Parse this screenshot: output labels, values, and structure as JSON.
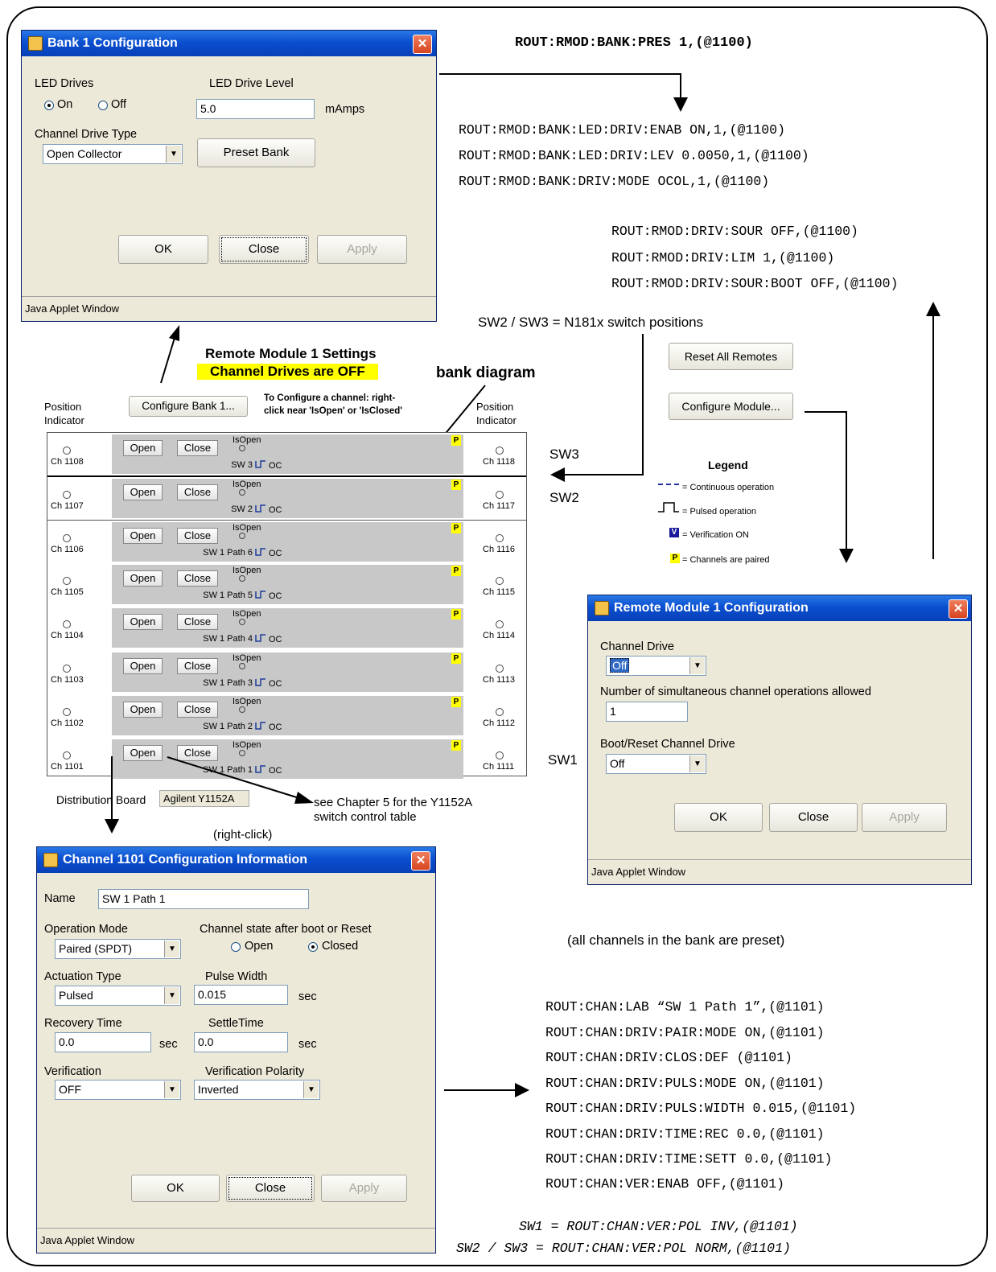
{
  "commands": {
    "top": "ROUT:RMOD:BANK:PRES 1,(@1100)",
    "bank": [
      "ROUT:RMOD:BANK:LED:DRIV:ENAB ON,1,(@1100)",
      "ROUT:RMOD:BANK:LED:DRIV:LEV 0.0050,1,(@1100)",
      "ROUT:RMOD:BANK:DRIV:MODE OCOL,1,(@1100)"
    ],
    "module": [
      "ROUT:RMOD:DRIV:SOUR OFF,(@1100)",
      "ROUT:RMOD:DRIV:LIM 1,(@1100)",
      "ROUT:RMOD:DRIV:SOUR:BOOT OFF,(@1100)"
    ],
    "channel": [
      "ROUT:CHAN:LAB “SW 1 Path 1”,(@1101)",
      "ROUT:CHAN:DRIV:PAIR:MODE ON,(@1101)",
      "ROUT:CHAN:DRIV:CLOS:DEF (@1101)",
      "ROUT:CHAN:DRIV:PULS:MODE ON,(@1101)",
      "ROUT:CHAN:DRIV:PULS:WIDTH 0.015,(@1101)",
      "ROUT:CHAN:DRIV:TIME:REC 0.0,(@1101)",
      "ROUT:CHAN:DRIV:TIME:SETT 0.0,(@1101)",
      "ROUT:CHAN:VER:ENAB OFF,(@1101)"
    ],
    "pol_sw1": "SW1 = ROUT:CHAN:VER:POL INV,(@1101)",
    "pol_sw23": "SW2 / SW3 = ROUT:CHAN:VER:POL NORM,(@1101)"
  },
  "annotations": {
    "switch_positions": "SW2 / SW3 = N181x switch positions",
    "bank_diagram": "bank diagram",
    "see_chapter": "see Chapter 5 for the Y1152A",
    "see_chapter2": "switch control table",
    "right_click": "(right-click)",
    "all_preset": "(all channels in the bank are preset)",
    "sw3": "SW3",
    "sw2": "SW2",
    "sw1": "SW1"
  },
  "bank_dialog": {
    "title": "Bank 1 Configuration",
    "led_drives_label": "LED Drives",
    "on_label": "On",
    "off_label": "Off",
    "led_level_label": "LED Drive Level",
    "led_level_value": "5.0",
    "led_level_unit": "mAmps",
    "drive_type_label": "Channel Drive Type",
    "drive_type_value": "Open Collector",
    "preset_bank": "Preset Bank",
    "ok": "OK",
    "close": "Close",
    "apply": "Apply",
    "footer": "Java Applet Window"
  },
  "panel": {
    "settings_title": "Remote Module 1 Settings",
    "drives_status": "Channel Drives are OFF",
    "position_indicator": "Position Indicator",
    "configure_bank": "Configure Bank 1...",
    "configure_hint1": "To Configure a channel: right-",
    "configure_hint2": "click near 'IsOpen' or 'IsClosed'",
    "reset_all": "Reset All Remotes",
    "configure_module": "Configure Module...",
    "distribution_label": "Distribution Board",
    "distribution_value": "Agilent Y1152A",
    "open": "Open",
    "close": "Close",
    "isopen": "IsOpen",
    "oc": "OC",
    "p": "P",
    "rows": [
      {
        "left": "Ch 1108",
        "right": "Ch 1118",
        "label": "SW 3"
      },
      {
        "left": "Ch 1107",
        "right": "Ch 1117",
        "label": "SW 2"
      },
      {
        "left": "Ch 1106",
        "right": "Ch 1116",
        "label": "SW 1 Path 6"
      },
      {
        "left": "Ch 1105",
        "right": "Ch 1115",
        "label": "SW 1 Path 5"
      },
      {
        "left": "Ch 1104",
        "right": "Ch 1114",
        "label": "SW 1 Path 4"
      },
      {
        "left": "Ch 1103",
        "right": "Ch 1113",
        "label": "SW 1 Path 3"
      },
      {
        "left": "Ch 1102",
        "right": "Ch 1112",
        "label": "SW 1 Path 2"
      },
      {
        "left": "Ch 1101",
        "right": "Ch 1111",
        "label": "SW 1 Path 1"
      }
    ]
  },
  "legend": {
    "title": "Legend",
    "continuous": "= Continuous operation",
    "pulsed": "= Pulsed operation",
    "verification": "= Verification ON",
    "paired": "= Channels are paired",
    "v": "V",
    "p": "P"
  },
  "module_dialog": {
    "title": "Remote Module 1 Configuration",
    "channel_drive_label": "Channel Drive",
    "channel_drive_value": "Off",
    "simultaneous_label": "Number of simultaneous channel operations allowed",
    "simultaneous_value": "1",
    "boot_label": "Boot/Reset Channel Drive",
    "boot_value": "Off",
    "ok": "OK",
    "close": "Close",
    "apply": "Apply",
    "footer": "Java Applet Window"
  },
  "channel_dialog": {
    "title": "Channel 1101 Configuration Information",
    "name_label": "Name",
    "name_value": "SW 1 Path 1",
    "op_mode_label": "Operation Mode",
    "op_mode_value": "Paired (SPDT)",
    "state_label": "Channel state after boot or Reset",
    "state_open": "Open",
    "state_closed": "Closed",
    "actuation_label": "Actuation Type",
    "actuation_value": "Pulsed",
    "pulse_width_label": "Pulse Width",
    "pulse_width_value": "0.015",
    "sec": "sec",
    "recovery_label": "Recovery Time",
    "recovery_value": "0.0",
    "settle_label": "SettleTime",
    "settle_value": "0.0",
    "verification_label": "Verification",
    "verification_value": "OFF",
    "polarity_label": "Verification Polarity",
    "polarity_value": "Inverted",
    "ok": "OK",
    "close": "Close",
    "apply": "Apply",
    "footer": "Java Applet Window"
  }
}
